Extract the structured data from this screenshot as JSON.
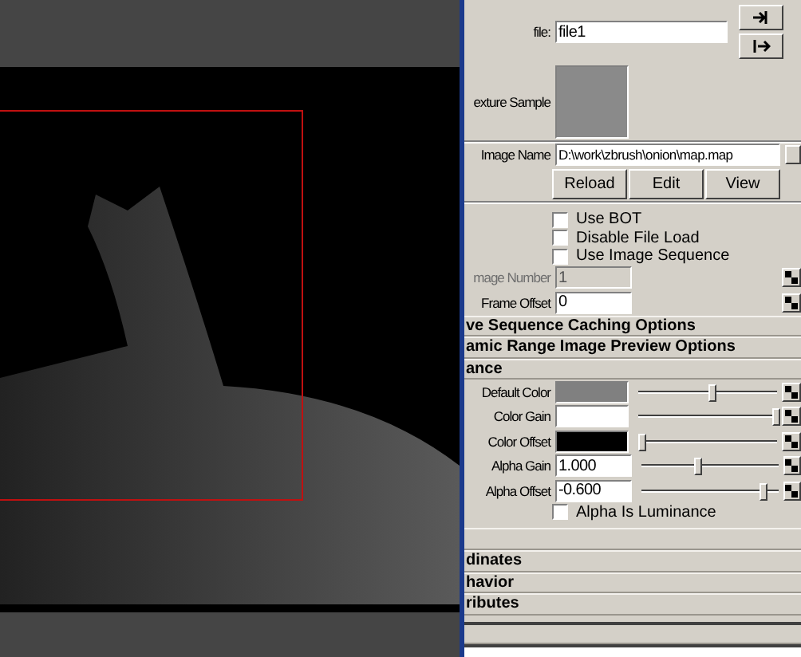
{
  "file": {
    "label": "file:",
    "value": "file1"
  },
  "texture_sample": {
    "label": "exture Sample"
  },
  "image_name": {
    "label": "Image Name",
    "value": "D:\\work\\zbrush\\onion\\map.map"
  },
  "buttons": [
    "Reload",
    "Edit",
    "View"
  ],
  "checkboxes": [
    {
      "label": "Use BOT",
      "checked": false
    },
    {
      "label": "Disable File Load",
      "checked": false
    },
    {
      "label": "Use Image Sequence",
      "checked": false
    }
  ],
  "image_number": {
    "label": "mage Number",
    "value": "1",
    "disabled": true
  },
  "frame_offset": {
    "label": "Frame Offset",
    "value": "0",
    "disabled": false
  },
  "sections_top": [
    "ve Sequence Caching Options",
    "amic Range Image Preview Options",
    "ance"
  ],
  "color_balance": [
    {
      "kind": "color",
      "label": "Default Color",
      "color": "#808080",
      "level": 0.51
    },
    {
      "kind": "color",
      "label": "Color Gain",
      "color": "#ffffff",
      "level": 0.98
    },
    {
      "kind": "color",
      "label": "Color Offset",
      "color": "#000000",
      "level": 0.0
    },
    {
      "kind": "number",
      "label": "Alpha Gain",
      "value": "1.000",
      "level": 0.39
    },
    {
      "kind": "number",
      "label": "Alpha Offset",
      "value": "-0.600",
      "level": 0.87
    }
  ],
  "alpha_is_luminance": {
    "label": "Alpha Is Luminance",
    "checked": false
  },
  "sections_bottom": [
    "dinates",
    "havior",
    "ributes"
  ]
}
